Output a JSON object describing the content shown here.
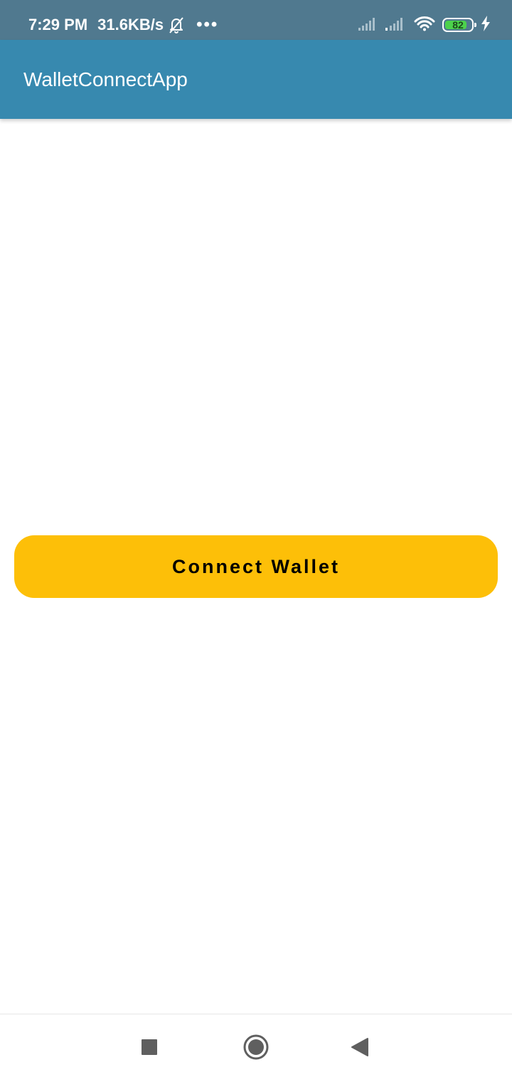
{
  "status_bar": {
    "time": "7:29 PM",
    "network_speed": "31.6KB/s",
    "more_dots": "•••",
    "battery_level": "82",
    "battery_fraction": 0.82,
    "icons": [
      "bell-off-icon",
      "signal-icon",
      "signal-icon",
      "wifi-icon",
      "battery-icon",
      "charging-icon"
    ]
  },
  "app_bar": {
    "title": "WalletConnectApp"
  },
  "main": {
    "connect_button_label": "Connect Wallet"
  },
  "nav_bar": {
    "icons": [
      "recents-icon",
      "home-icon",
      "back-icon"
    ]
  },
  "colors": {
    "status_bar_bg": "#50798f",
    "app_bar_bg": "#3789af",
    "button_bg": "#fdbf08",
    "battery_fill": "#4cd24c"
  }
}
